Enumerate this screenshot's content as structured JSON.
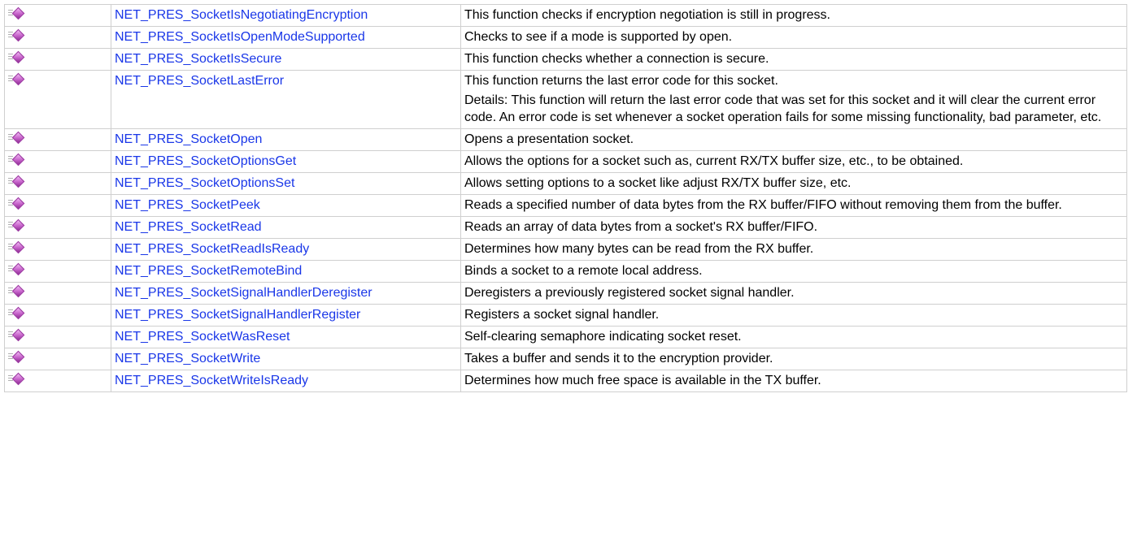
{
  "rows": [
    {
      "name": "NET_PRES_SocketIsNegotiatingEncryption",
      "description": [
        "This function checks if encryption negotiation is still in progress."
      ]
    },
    {
      "name": "NET_PRES_SocketIsOpenModeSupported",
      "description": [
        "Checks to see if a mode is supported by open."
      ]
    },
    {
      "name": "NET_PRES_SocketIsSecure",
      "description": [
        "This function checks whether a connection is secure."
      ]
    },
    {
      "name": "NET_PRES_SocketLastError",
      "description": [
        "This function returns the last error code for this socket.",
        "Details: This function will return the last error code that was set for this socket and it will clear the current error code. An error code is set whenever a socket operation fails for some missing functionality, bad parameter, etc."
      ]
    },
    {
      "name": "NET_PRES_SocketOpen",
      "description": [
        "Opens a presentation socket."
      ]
    },
    {
      "name": "NET_PRES_SocketOptionsGet",
      "description": [
        "Allows the options for a socket such as, current RX/TX buffer size, etc., to be obtained."
      ]
    },
    {
      "name": "NET_PRES_SocketOptionsSet",
      "description": [
        "Allows setting options to a socket like adjust RX/TX buffer size, etc."
      ]
    },
    {
      "name": "NET_PRES_SocketPeek",
      "description": [
        "Reads a specified number of data bytes from the RX buffer/FIFO without removing them from the buffer."
      ]
    },
    {
      "name": "NET_PRES_SocketRead",
      "description": [
        "Reads an array of data bytes from a socket's RX buffer/FIFO."
      ]
    },
    {
      "name": "NET_PRES_SocketReadIsReady",
      "description": [
        "Determines how many bytes can be read from the RX buffer."
      ]
    },
    {
      "name": "NET_PRES_SocketRemoteBind",
      "description": [
        "Binds a socket to a remote local address."
      ]
    },
    {
      "name": "NET_PRES_SocketSignalHandlerDeregister",
      "description": [
        "Deregisters a previously registered socket signal handler."
      ]
    },
    {
      "name": "NET_PRES_SocketSignalHandlerRegister",
      "description": [
        "Registers a socket signal handler."
      ]
    },
    {
      "name": "NET_PRES_SocketWasReset",
      "description": [
        "Self-clearing semaphore indicating socket reset."
      ]
    },
    {
      "name": "NET_PRES_SocketWrite",
      "description": [
        "Takes a buffer and sends it to the encryption provider."
      ]
    },
    {
      "name": "NET_PRES_SocketWriteIsReady",
      "description": [
        "Determines how much free space is available in the TX buffer."
      ]
    }
  ],
  "icons": {
    "row_icon": "public-method-icon"
  },
  "colors": {
    "link": "#1a37e8",
    "border": "#cfcfcf",
    "icon": "#c561c9"
  }
}
